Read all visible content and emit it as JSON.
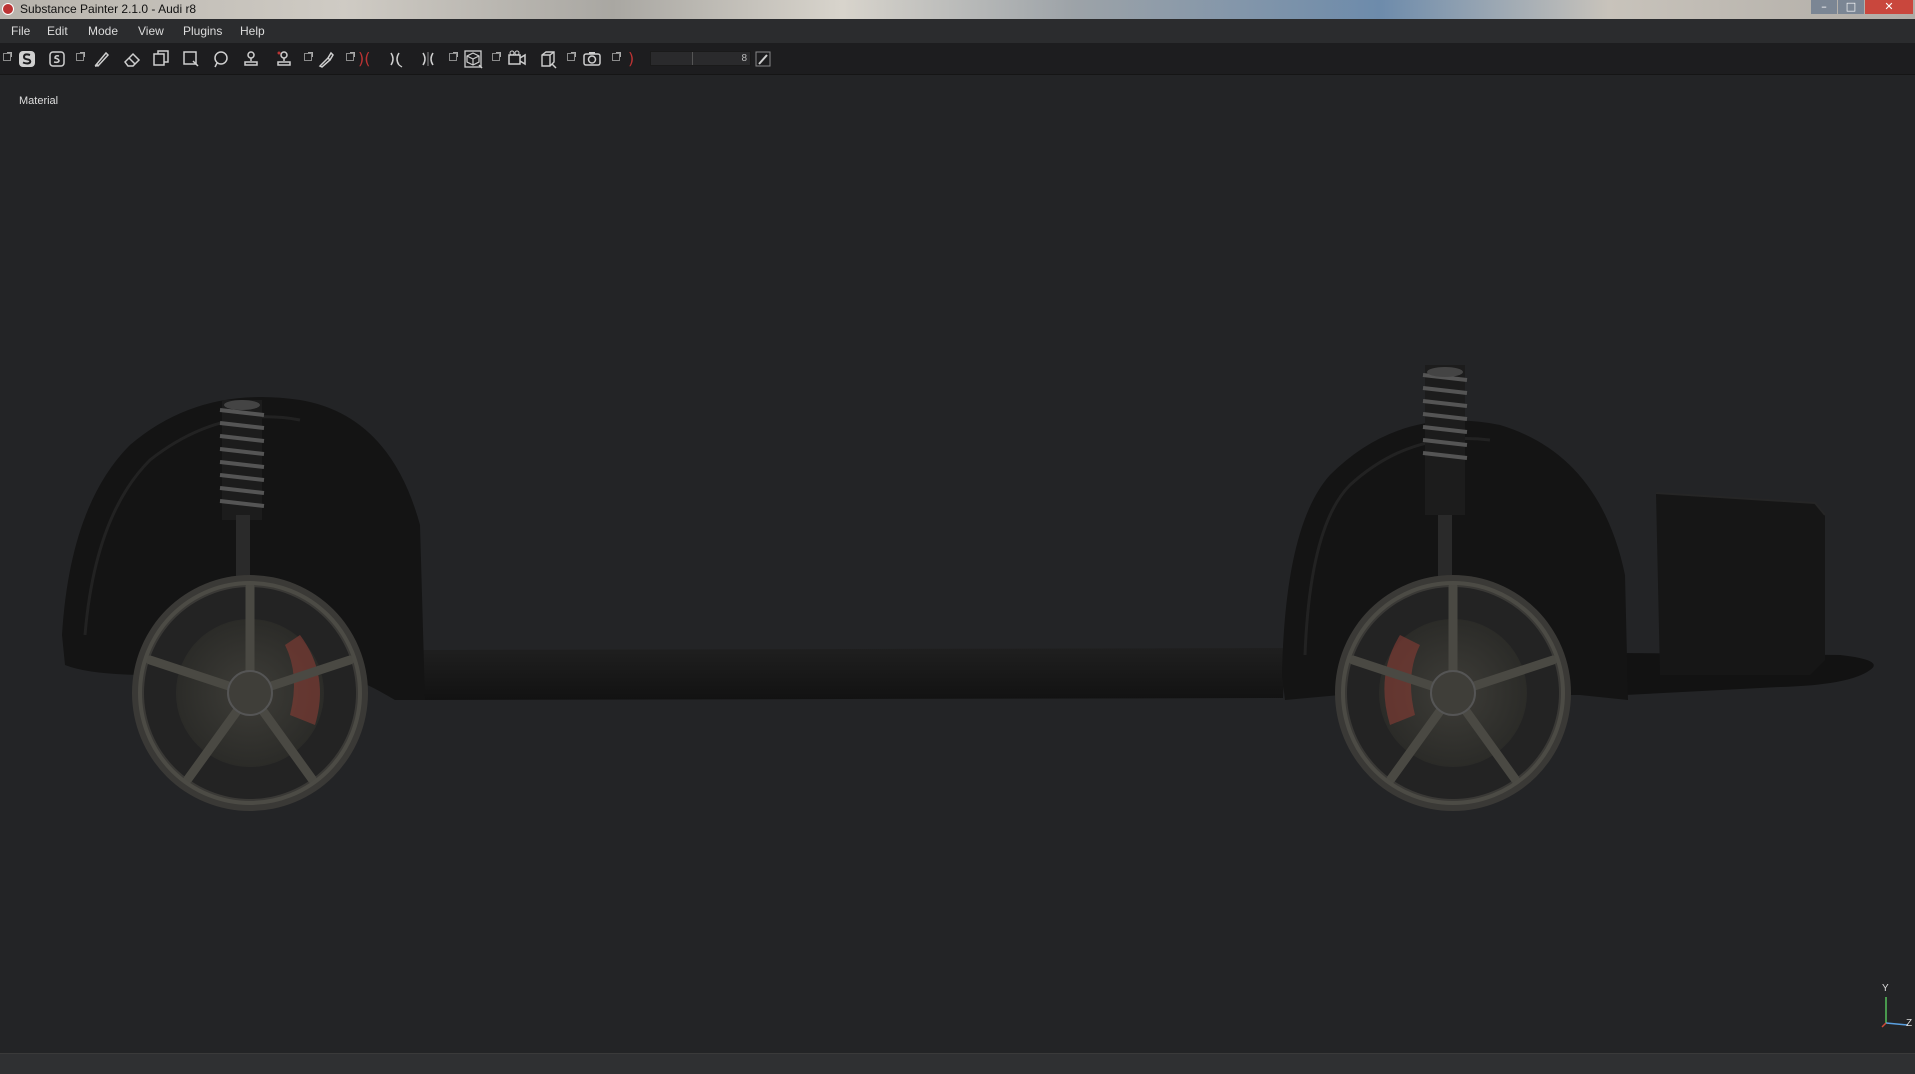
{
  "window": {
    "title": "Substance Painter 2.1.0 - Audi r8",
    "controls": {
      "minimize": "–",
      "maximize": "□",
      "close": "✕"
    }
  },
  "menu": {
    "items": [
      "File",
      "Edit",
      "Mode",
      "View",
      "Plugins",
      "Help"
    ]
  },
  "toolbar": {
    "tools": [
      "substance-logo-icon",
      "save-icon",
      "paint-brush-icon",
      "eraser-icon",
      "projection-icon",
      "polygon-fill-icon",
      "smudge-icon",
      "clone-stamp-icon",
      "material-picker-icon",
      "color-picker-icon",
      "symmetry-x-icon",
      "symmetry-y-icon",
      "symmetry-z-icon",
      "camera-cube-icon",
      "camera-icon",
      "uv-box-icon",
      "screenshot-icon",
      "brush-spacing-icon",
      "pen-pressure-icon"
    ],
    "slider_value": "8"
  },
  "viewport": {
    "label": "Material",
    "axis": {
      "y": "Y",
      "z": "Z"
    }
  },
  "colors": {
    "background": "#232426",
    "titlebar_close": "#c9473d",
    "brake_caliper": "#7a3a33"
  }
}
